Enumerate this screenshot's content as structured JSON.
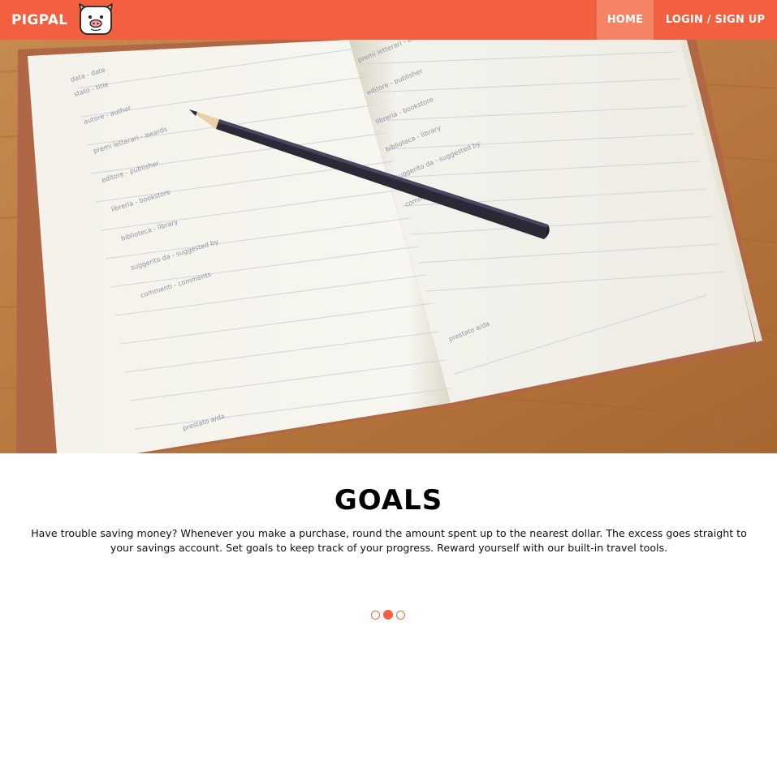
{
  "navbar": {
    "brand": "PIGPAL",
    "logo_icon": "pig-face-icon",
    "links": [
      "HOME",
      "LOGIN / SIGN UP"
    ],
    "active_link": "HOME"
  },
  "colors": {
    "accent": "#f2603f",
    "active_nav": "#f58466"
  },
  "slide": {
    "title": "GOALS",
    "text": "Have trouble saving money? Whenever you make a purchase, round the amount spent up to the nearest dollar. The excess goes straight to your savings account. Set goals to keep track of your progress. Reward yourself with our built-in travel tools.",
    "indicator": {
      "count": 3,
      "active_index": 1
    }
  },
  "hero": {
    "left_page_lines": [
      "data - date",
      "stato - title",
      "autore - author",
      "premi letterari - awards",
      "editore - publisher",
      "libreria - bookstore",
      "biblioteca - library",
      "suggerito da - suggested by",
      "commenti - comments",
      "prestato a/da"
    ],
    "right_page_lines": [
      "premi letterari - awards",
      "editore - publisher",
      "libreria - bookstore",
      "biblioteca - library",
      "suggerito da - suggested by",
      "commenti",
      "prestato a/da"
    ]
  }
}
